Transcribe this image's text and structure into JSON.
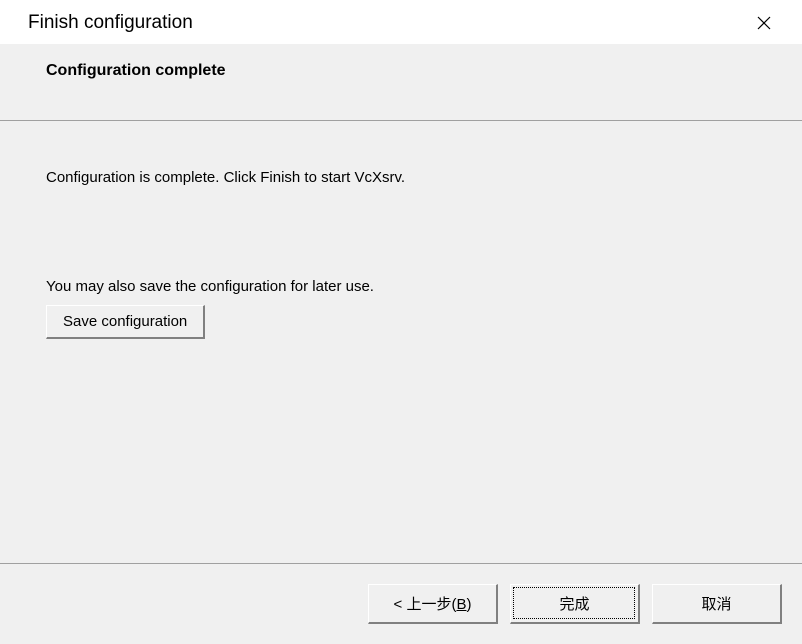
{
  "titlebar": {
    "title": "Finish configuration"
  },
  "header": {
    "title": "Configuration complete"
  },
  "content": {
    "main_text": "Configuration is complete. Click Finish to start VcXsrv.",
    "sub_text": "You may also save the configuration for later use.",
    "save_button_label": "Save configuration"
  },
  "footer": {
    "back_prefix": "< 上一步(",
    "back_key": "B",
    "back_suffix": ")",
    "finish_label": "完成",
    "cancel_label": "取消"
  }
}
